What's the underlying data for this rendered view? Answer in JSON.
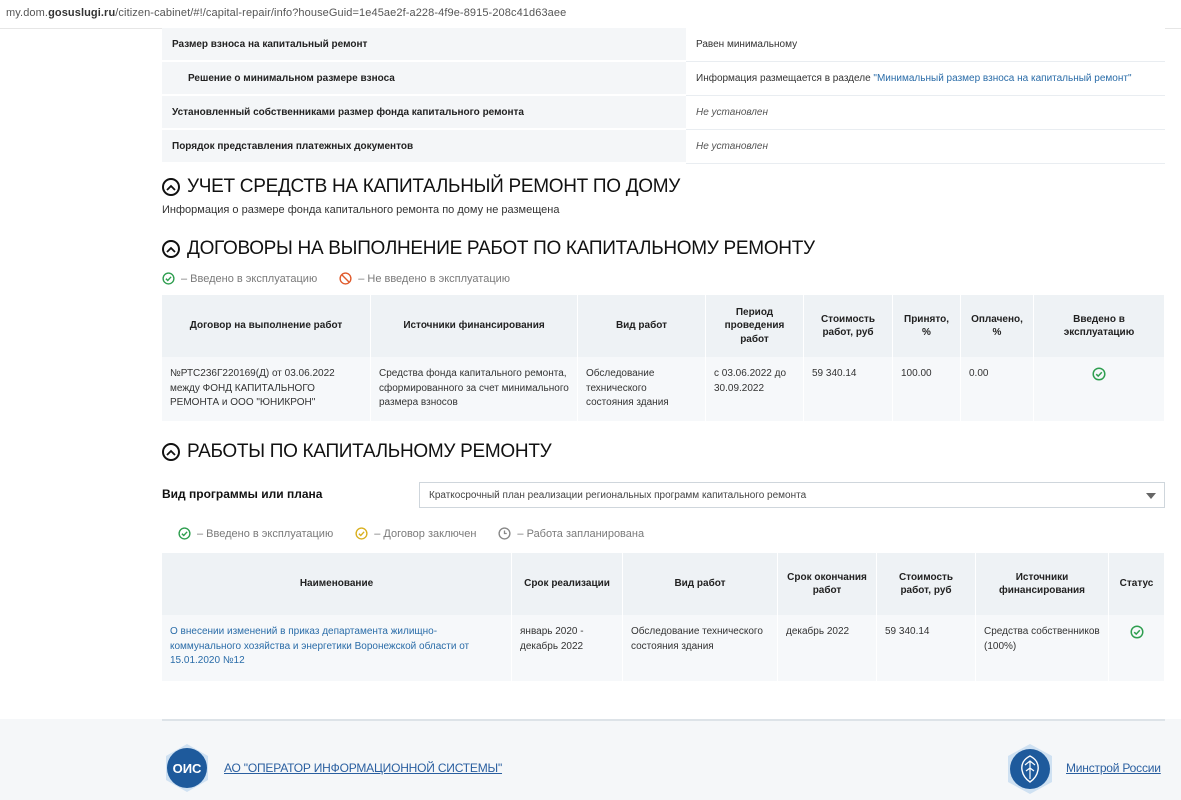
{
  "browser": {
    "url_prefix": "my.dom.",
    "url_domain": "gosuslugi.ru",
    "url_rest": "/citizen-cabinet/#!/capital-repair/info?houseGuid=1e45ae2f-a228-4f9e-8915-208c41d63aee"
  },
  "info_rows": [
    {
      "label": "Размер взноса на капитальный ремонт",
      "value": "Равен минимальному"
    },
    {
      "label": "Решение о минимальном размере взноса",
      "value_prefix": "Информация размещается в разделе ",
      "value_link": "\"Минимальный размер взноса на капитальный ремонт\""
    },
    {
      "label": "Установленный собственниками размер фонда капитального ремонта",
      "value": "Не установлен"
    },
    {
      "label": "Порядок представления платежных документов",
      "value": "Не установлен"
    }
  ],
  "section_funds": {
    "title": "УЧЕТ СРЕДСТВ НА КАПИТАЛЬНЫЙ РЕМОНТ ПО ДОМУ",
    "note": "Информация о размере фонда капитального ремонта по дому не размещена"
  },
  "section_contracts": {
    "title": "ДОГОВОРЫ НА ВЫПОЛНЕНИЕ РАБОТ ПО КАПИТАЛЬНОМУ РЕМОНТУ",
    "legend": [
      "– Введено в эксплуатацию",
      "– Не введено в эксплуатацию"
    ],
    "headers": [
      "Договор на выполнение работ",
      "Источники финансирования",
      "Вид работ",
      "Период проведения работ",
      "Стоимость работ, руб",
      "Принято, %",
      "Оплачено, %",
      "Введено в эксплуатацию"
    ],
    "rows": [
      {
        "contract": "№РТС236Г220169(Д) от 03.06.2022 между ФОНД КАПИТАЛЬНОГО РЕМОНТА и ООО \"ЮНИКРОН\"",
        "source": "Средства фонда капитального ремонта, сформированного за счет минимального размера взносов",
        "work_type": "Обследование технического состояния здания",
        "period": "с 03.06.2022 до 30.09.2022",
        "cost": "59 340.14",
        "accepted": "100.00",
        "paid": "0.00",
        "commissioned_icon": "check-circle-icon"
      }
    ]
  },
  "section_works": {
    "title": "РАБОТЫ ПО КАПИТАЛЬНОМУ РЕМОНТУ",
    "plan_label": "Вид программы или плана",
    "plan_value": "Краткосрочный план реализации региональных программ капитального ремонта",
    "legend": [
      "– Введено в эксплуатацию",
      "– Договор заключен",
      "– Работа запланирована"
    ],
    "headers": [
      "Наименование",
      "Срок реализации",
      "Вид работ",
      "Срок окончания работ",
      "Стоимость работ, руб",
      "Источники финансирования",
      "Статус"
    ],
    "rows": [
      {
        "name": "О внесении изменений в приказ департамента жилищно-коммунального хозяйства и энергетики Воронежской области от 15.01.2020 №12",
        "term": "январь 2020 - декабрь 2022",
        "work_type": "Обследование технического состояния здания",
        "end": "декабрь 2022",
        "cost": "59 340.14",
        "source": "Средства собственников (100%)",
        "status_icon": "check-circle-icon"
      }
    ]
  },
  "footer": {
    "ois_logo_text": "ОИС",
    "ois_link": "АО \"ОПЕРАТОР ИНФОРМАЦИОННОЙ СИСТЕМЫ\"",
    "ministry_link": "Минстрой России"
  },
  "colors": {
    "green": "#2e9e4f",
    "red": "#e05a2b",
    "yellow": "#d9b020",
    "gray": "#888888",
    "link": "#2a6ca8",
    "ois_blue": "#1e5a9c"
  }
}
